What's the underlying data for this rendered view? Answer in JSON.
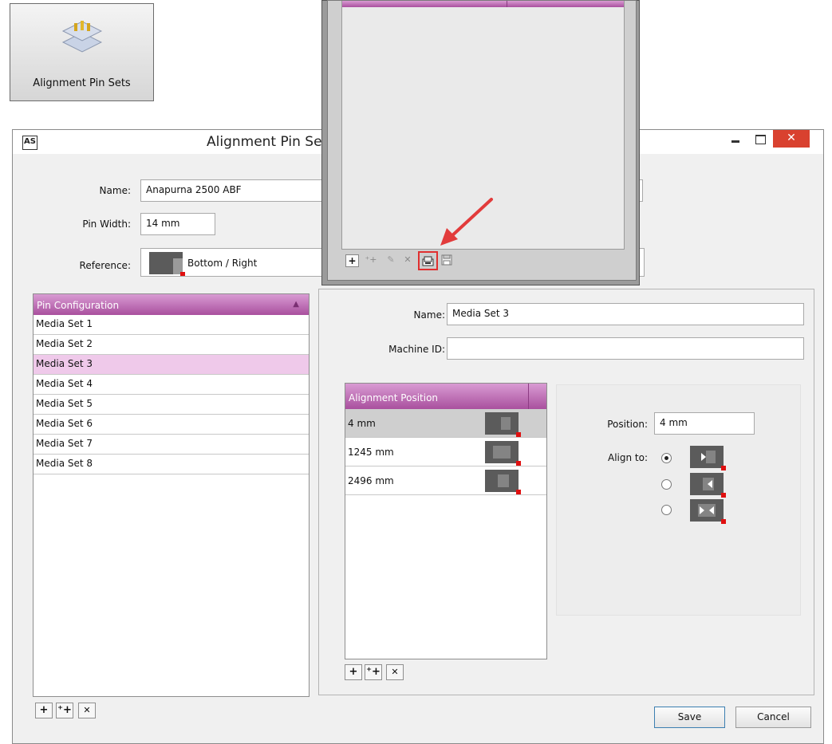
{
  "toolbar_button": {
    "label": "Alignment Pin Sets",
    "icon": "alignment-pin-sets-icon"
  },
  "window": {
    "app_badge": "AS",
    "title": "Alignment Pin Set",
    "close_color": "#d9412f"
  },
  "form": {
    "name_label": "Name:",
    "name_value": "Anapurna 2500 ABF",
    "pin_width_label": "Pin Width:",
    "pin_width_value": "14 mm",
    "reference_label": "Reference:",
    "reference_value": "Bottom / Right"
  },
  "pin_config": {
    "header": "Pin Configuration",
    "items": [
      "Media Set 1",
      "Media Set 2",
      "Media Set 3",
      "Media Set 4",
      "Media Set 5",
      "Media Set 6",
      "Media Set 7",
      "Media Set 8"
    ],
    "selected_index": 2,
    "buttons": [
      "+",
      "⁺+",
      "✕"
    ]
  },
  "details": {
    "name_label": "Name:",
    "name_value": "Media Set 3",
    "machine_id_label": "Machine ID:",
    "machine_id_value": "",
    "positions_header": "Alignment Position",
    "positions": [
      {
        "value": "4 mm",
        "icon": "align-right-icon"
      },
      {
        "value": "1245 mm",
        "icon": "align-center-icon"
      },
      {
        "value": "2496 mm",
        "icon": "align-left-icon"
      }
    ],
    "position_buttons": [
      "+",
      "⁺+",
      "✕"
    ],
    "position_label": "Position:",
    "position_value": "4 mm",
    "align_to_label": "Align to:",
    "align_selected": 0
  },
  "footer": {
    "save": "Save",
    "cancel": "Cancel"
  },
  "popup": {
    "toolbar_buttons": [
      "+",
      "⁺+",
      "✎",
      "✕",
      "import",
      "save"
    ],
    "highlight_color": "#e03030",
    "accent": "#b25aa8"
  }
}
